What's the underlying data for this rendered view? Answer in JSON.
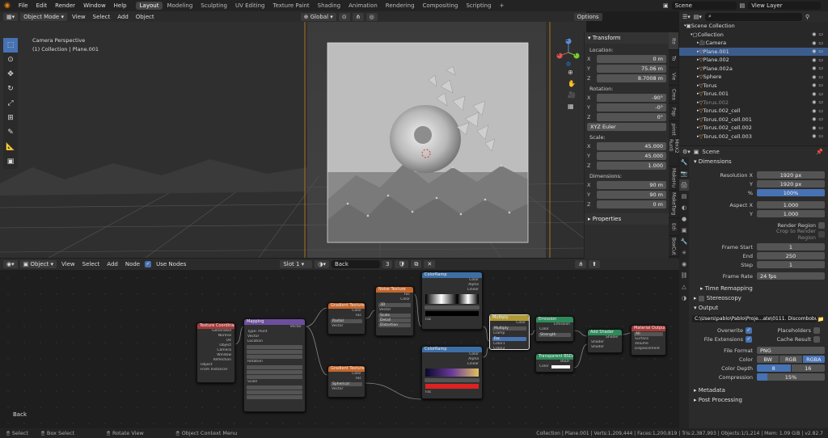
{
  "topbar": {
    "menus": [
      "File",
      "Edit",
      "Render",
      "Window",
      "Help"
    ],
    "workspaces": [
      "Layout",
      "Modeling",
      "Sculpting",
      "UV Editing",
      "Texture Paint",
      "Shading",
      "Animation",
      "Rendering",
      "Compositing",
      "Scripting"
    ],
    "active_workspace": "Layout",
    "scene": "Scene",
    "view_layer": "View Layer"
  },
  "viewport": {
    "mode": "Object Mode",
    "menus": [
      "View",
      "Select",
      "Add",
      "Object"
    ],
    "transform_orientation": "Global",
    "options": "Options",
    "overlay_line1": "Camera Perspective",
    "overlay_line2": "(1) Collection | Plane.001",
    "gizmo": {
      "x": "X",
      "y": "Y",
      "z": "Z"
    }
  },
  "npanel": {
    "header": "Transform",
    "location_label": "Location:",
    "location": [
      {
        "axis": "X",
        "value": "0 m"
      },
      {
        "axis": "Y",
        "value": "75.06 m"
      },
      {
        "axis": "Z",
        "value": "8.7008 m"
      }
    ],
    "rotation_label": "Rotation:",
    "rotation": [
      {
        "axis": "X",
        "value": "-90°"
      },
      {
        "axis": "Y",
        "value": "-0°"
      },
      {
        "axis": "Z",
        "value": "0°"
      }
    ],
    "rotation_mode": "XYZ Euler",
    "scale_label": "Scale:",
    "scale": [
      {
        "axis": "X",
        "value": "45.000"
      },
      {
        "axis": "Y",
        "value": "45.000"
      },
      {
        "axis": "Z",
        "value": "1.000"
      }
    ],
    "dimensions_label": "Dimensions:",
    "dimensions": [
      {
        "axis": "X",
        "value": "90 m"
      },
      {
        "axis": "Y",
        "value": "90 m"
      },
      {
        "axis": "Z",
        "value": "0 m"
      }
    ],
    "properties_header": "Properties",
    "tabs": [
      "Ite",
      "To",
      "Vie",
      "Crea",
      "Pap",
      "pinst",
      "MHX2 Runti",
      "MakeHu",
      "MakeTarg",
      "Edi",
      "BoxCut"
    ]
  },
  "outliner": {
    "search_placeholder": "",
    "rows": [
      {
        "name": "Scene Collection",
        "indent": 0
      },
      {
        "name": "Collection",
        "indent": 1
      },
      {
        "name": "Camera",
        "indent": 2
      },
      {
        "name": "Plane.001",
        "indent": 2,
        "selected": true
      },
      {
        "name": "Plane.002",
        "indent": 2
      },
      {
        "name": "Plane.002a",
        "indent": 2
      },
      {
        "name": "Sphere",
        "indent": 2
      },
      {
        "name": "Torus",
        "indent": 2
      },
      {
        "name": "Torus.001",
        "indent": 2
      },
      {
        "name": "Torus.002",
        "indent": 2
      },
      {
        "name": "Torus.002_cell",
        "indent": 2
      },
      {
        "name": "Torus.002_cell.001",
        "indent": 2
      },
      {
        "name": "Torus.002_cell.002",
        "indent": 2
      },
      {
        "name": "Torus.002_cell.003",
        "indent": 2
      }
    ]
  },
  "properties": {
    "context": "Scene",
    "dimensions_header": "Dimensions",
    "resolution_x_label": "Resolution X",
    "resolution_x": "1920 px",
    "resolution_y_label": "Y",
    "resolution_y": "1920 px",
    "resolution_pct_label": "%",
    "resolution_pct": "100%",
    "aspect_x_label": "Aspect X",
    "aspect_x": "1.000",
    "aspect_y_label": "Y",
    "aspect_y": "1.000",
    "render_region": "Render Region",
    "crop": "Crop to Render Region",
    "frame_start_label": "Frame Start",
    "frame_start": "1",
    "frame_end_label": "End",
    "frame_end": "250",
    "frame_step_label": "Step",
    "frame_step": "1",
    "frame_rate_label": "Frame Rate",
    "frame_rate": "24 fps",
    "time_remapping": "Time Remapping",
    "stereoscopy": "Stereoscopy",
    "output_header": "Output",
    "output_path": "C:\\Users\\pablo\\Pablo\\Proje...ate\\0111. Discombobulate",
    "overwrite": "Overwrite",
    "placeholders": "Placeholders",
    "file_extensions": "File Extensions",
    "cache_result": "Cache Result",
    "file_format_label": "File Format",
    "file_format": "PNG",
    "color_label": "Color",
    "color_options": [
      "BW",
      "RGB",
      "RGBA"
    ],
    "color_depth_label": "Color Depth",
    "color_depth_options": [
      "8",
      "16"
    ],
    "compression_label": "Compression",
    "compression": "15%",
    "compression_fraction": 0.15,
    "metadata": "Metadata",
    "post_processing": "Post Processing"
  },
  "node_editor": {
    "type": "Object",
    "menus": [
      "View",
      "Select",
      "Add",
      "Node"
    ],
    "use_nodes": "Use Nodes",
    "slot": "Slot 1",
    "material": "Back",
    "users": "3",
    "label": "Back",
    "nodes": {
      "texcoord": {
        "title": "Texture Coordinate",
        "rows": [
          "Generated",
          "Normal",
          "UV",
          "Object",
          "Camera",
          "Window",
          "Reflection",
          "Object",
          "From Instancer"
        ]
      },
      "mapping": {
        "title": "Mapping",
        "rows": [
          "Vector",
          "Type:",
          "Point",
          "Vector",
          "Location",
          "X",
          "Y",
          "Z",
          "Rotation",
          "X",
          "Y",
          "Z",
          "Scale",
          "X",
          "Y",
          "Z"
        ]
      },
      "gradient1": {
        "title": "Gradient Texture",
        "rows": [
          "Color",
          "Fac",
          "Radial",
          "Vector"
        ]
      },
      "noise": {
        "title": "Noise Texture",
        "rows": [
          "Fac",
          "Color",
          "3D",
          "Vector",
          "Scale",
          "Detail",
          "Distortion"
        ]
      },
      "ramp1": {
        "title": "ColorRamp",
        "rows": [
          "Color",
          "Alpha",
          "Linear",
          "Fac"
        ]
      },
      "mix": {
        "title": "Multiply",
        "rows": [
          "Color",
          "Multiply",
          "Clamp",
          "Fac",
          "Color1",
          "Color2"
        ]
      },
      "emission": {
        "title": "Emission",
        "rows": [
          "Emission",
          "Color",
          "Strength"
        ]
      },
      "gradient2": {
        "title": "Gradient Texture",
        "rows": [
          "Color",
          "Fac",
          "Spherical",
          "Vector"
        ]
      },
      "ramp2": {
        "title": "ColorRamp",
        "rows": [
          "Color",
          "Alpha",
          "Linear",
          "Fac"
        ]
      },
      "transparent": {
        "title": "Transparent BSDF",
        "rows": [
          "BSDF",
          "Color"
        ]
      },
      "addshader": {
        "title": "Add Shader",
        "rows": [
          "Shader",
          "Shader",
          "Shader"
        ]
      },
      "output": {
        "title": "Material Output",
        "rows": [
          "All",
          "Surface",
          "Volume",
          "Displacement"
        ]
      }
    }
  },
  "statusbar": {
    "select": "Select",
    "box_select": "Box Select",
    "rotate_view": "Rotate View",
    "context_menu": "Object Context Menu",
    "stats": "Collection | Plane.001 | Verts:1,209,444 | Faces:1,200,819 | Tris:2,387,993 | Objects:1/1,214 | Mem: 1.09 GiB | v2.82.7"
  },
  "colors": {
    "accent": "#4772b3",
    "selection": "#3c5c8c",
    "header_orange": "#c4652a",
    "header_purple": "#6c4f9c",
    "header_blue": "#3d6fa5",
    "header_yellow": "#b09a33",
    "header_green": "#2e8a5a",
    "header_red": "#a63a3a"
  }
}
